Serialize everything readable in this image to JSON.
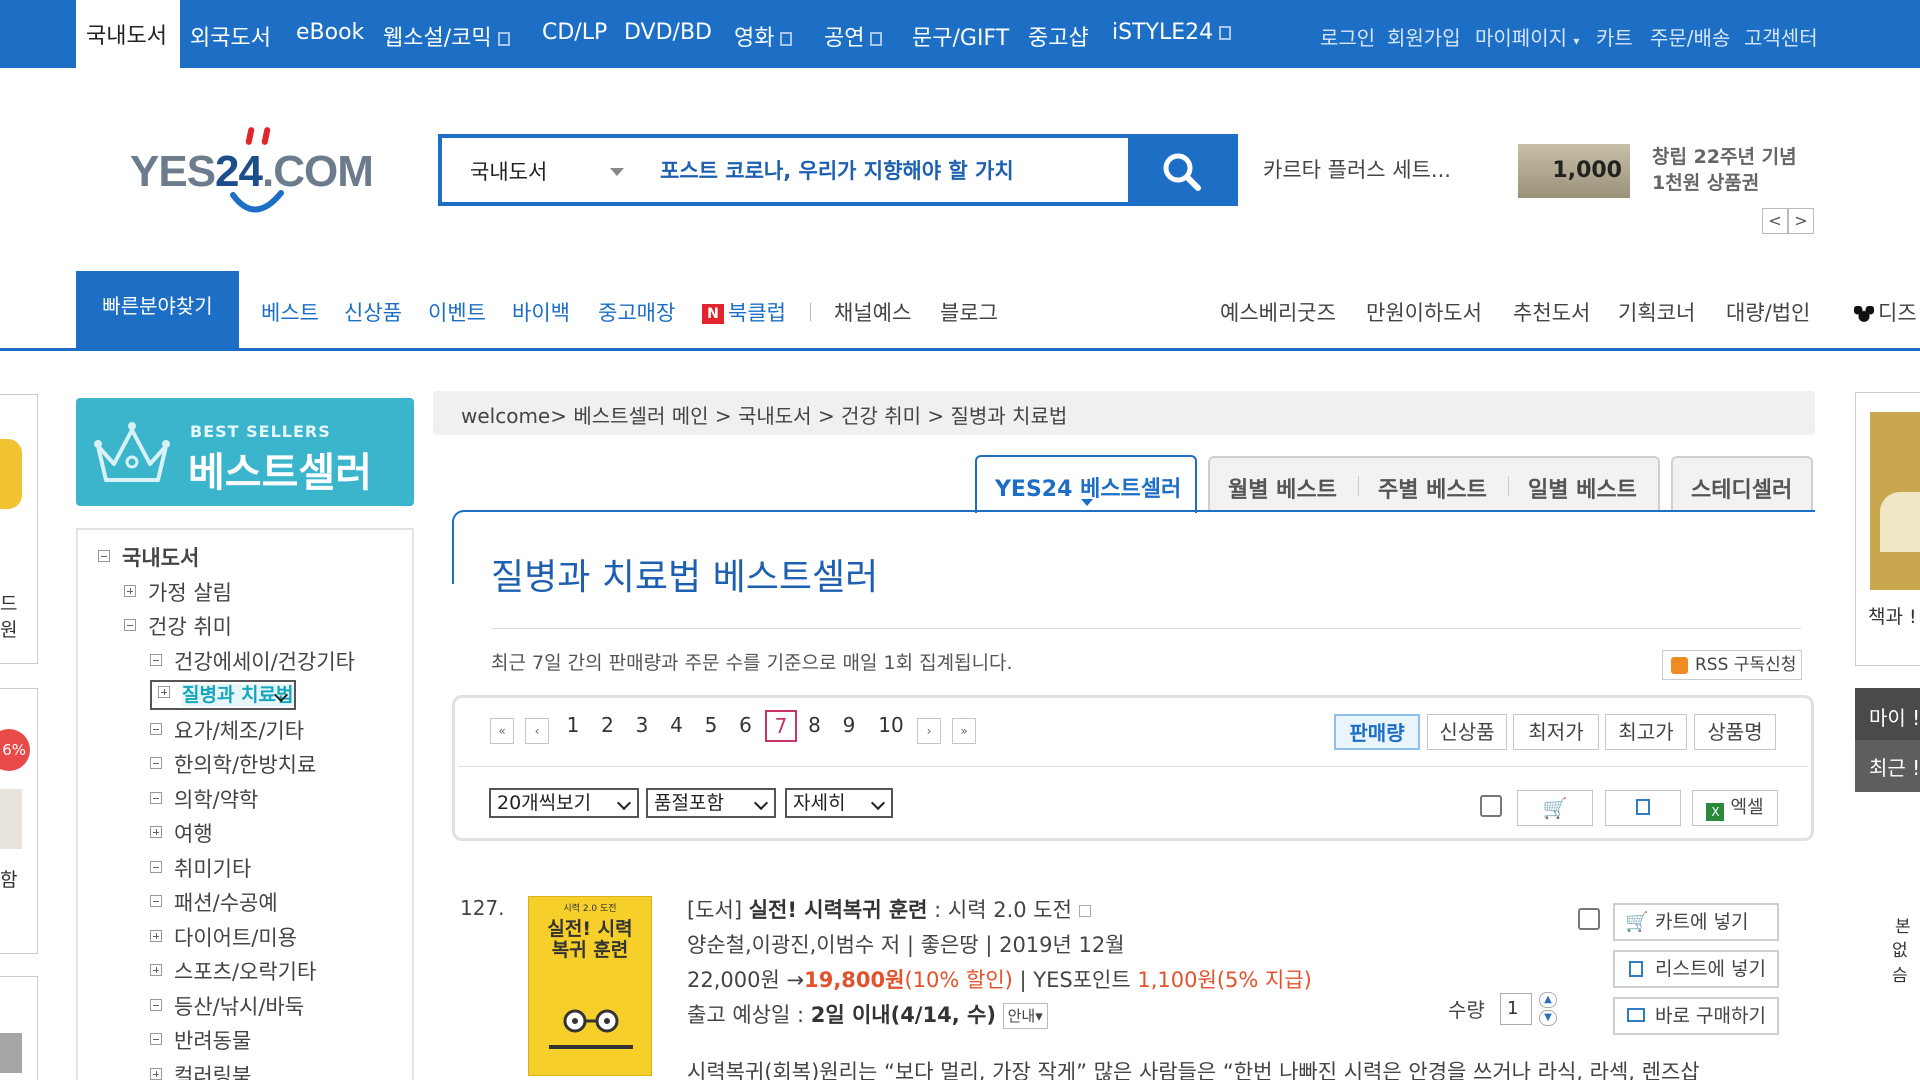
{
  "topbar": {
    "active": "국내도서",
    "categories": [
      "외국도서",
      "eBook",
      "웹소설/코믹",
      "CD/LP",
      "DVD/BD",
      "영화",
      "공연",
      "문구/GIFT",
      "중고샵",
      "iSTYLE24"
    ],
    "user_links": [
      "로그인",
      "회원가입",
      "마이페이지",
      "카트",
      "주문/배송",
      "고객센터"
    ]
  },
  "header": {
    "logo_text": "YES24.COM",
    "search_category": "국내도서",
    "search_query": "포스트 코로나, 우리가 지향해야 할 가치",
    "ad_text": "카르타 플러스 세트...",
    "coupon_amount": "1,000",
    "coupon_text_1": "창립 22주년 기념",
    "coupon_text_2": "1천원 상품권",
    "prev": "<",
    "next": ">"
  },
  "nav": {
    "quick": "빠른분야찾기",
    "items": [
      "베스트",
      "신상품",
      "이벤트",
      "바이백",
      "중고매장"
    ],
    "bookclub_badge": "N",
    "bookclub": "북클럽",
    "items2": [
      "채널예스",
      "블로그"
    ],
    "right": [
      "예스베리굿즈",
      "만원이하도서",
      "추천도서",
      "기획코너",
      "대량/법인",
      "디즈"
    ]
  },
  "left": {
    "banner_small": "BEST SELLERS",
    "banner_big": "베스트셀러",
    "panel_text_1": "드",
    "panel_text_2": "원",
    "panel_badge": "6%",
    "panel_text_3": "함",
    "tree": [
      {
        "label": "국내도서",
        "level": 0,
        "sign": "minus"
      },
      {
        "label": "가정 살림",
        "level": 1,
        "sign": "plus"
      },
      {
        "label": "건강 취미",
        "level": 1,
        "sign": "minus"
      },
      {
        "label": "건강에세이/건강기타",
        "level": 2,
        "sign": "minus"
      },
      {
        "label": "질병과 치료법",
        "level": 2,
        "sign": "plus",
        "selected": true
      },
      {
        "label": "요가/체조/기타",
        "level": 2,
        "sign": "minus"
      },
      {
        "label": "한의학/한방치료",
        "level": 2,
        "sign": "minus"
      },
      {
        "label": "의학/약학",
        "level": 2,
        "sign": "minus"
      },
      {
        "label": "여행",
        "level": 2,
        "sign": "plus"
      },
      {
        "label": "취미기타",
        "level": 2,
        "sign": "minus"
      },
      {
        "label": "패션/수공예",
        "level": 2,
        "sign": "minus"
      },
      {
        "label": "다이어트/미용",
        "level": 2,
        "sign": "plus"
      },
      {
        "label": "스포츠/오락기타",
        "level": 2,
        "sign": "plus"
      },
      {
        "label": "등산/낚시/바둑",
        "level": 2,
        "sign": "minus"
      },
      {
        "label": "반려동물",
        "level": 2,
        "sign": "minus"
      },
      {
        "label": "컬러링북",
        "level": 2,
        "sign": "plus"
      }
    ]
  },
  "main": {
    "breadcrumb": "welcome> 베스트셀러 메인 > 국내도서 > 건강 취미 > 질병과 치료법",
    "tabs": [
      "YES24 베스트셀러",
      "월별 베스트",
      "주별 베스트",
      "일별 베스트",
      "스테디셀러"
    ],
    "title": "질병과 치료법 베스트셀러",
    "description": "최근 7일 간의 판매량과 주문 수를 기준으로 매일 1회 집계됩니다.",
    "rss": "RSS 구독신청",
    "pages": [
      "1",
      "2",
      "3",
      "4",
      "5",
      "6",
      "7",
      "8",
      "9",
      "10"
    ],
    "current_page": "7",
    "sorts": [
      "판매량",
      "신상품",
      "최저가",
      "최고가",
      "상품명"
    ],
    "view_select": "20개씩보기",
    "stock_select": "품절포함",
    "detail_select": "자세히",
    "excel": "엑셀"
  },
  "book": {
    "rank": "127.",
    "cover_sub": "시력 2.0 도전",
    "cover_title": "실전! 시력복귀 훈련",
    "type": "[도서]",
    "title": "실전! 시력복귀 훈련",
    "subtitle": ": 시력 2.0 도전",
    "authors": "양순철,이광진,이범수 저",
    "publisher": "좋은땅",
    "date": "2019년 12월",
    "list_price": "22,000원",
    "sale_price": "19,800원",
    "discount": "(10% 할인)",
    "point_label": "YES포인트",
    "point": "1,100원",
    "point_rate": "(5% 지급)",
    "ship_label": "출고 예상일 :",
    "ship": "2일 이내(4/14, 수)",
    "guide": "안내",
    "qty_label": "수량",
    "qty": "1",
    "cart_btn": "카트에 넣기",
    "list_btn": "리스트에 넣기",
    "buy_btn": "바로 구매하기",
    "summary": "시력복귀(회복)원리는 “보다 멀리, 가장 작게” 많은 사람들은 “한번 나빠진 시력은 안경을 쓰거나 라식, 라섹, 렌즈삽"
  },
  "right": {
    "book_caption": "책과 !",
    "dark_1": "마이 !",
    "dark_2": "최근 !",
    "side_text_1": "본",
    "side_text_2": "없슴"
  },
  "colors": {
    "brand": "#1d6fc6",
    "bestseller": "#3ab5cb",
    "price": "#e3522b"
  }
}
